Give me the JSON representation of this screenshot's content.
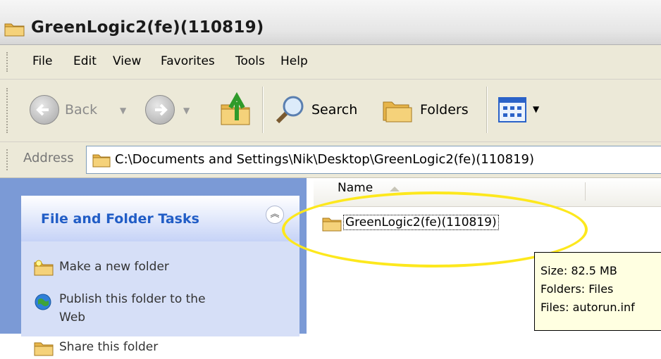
{
  "window": {
    "title": "GreenLogic2(fe)(110819)"
  },
  "menu": [
    {
      "label": "File"
    },
    {
      "label": "Edit"
    },
    {
      "label": "View"
    },
    {
      "label": "Favorites"
    },
    {
      "label": "Tools"
    },
    {
      "label": "Help"
    }
  ],
  "toolbar": {
    "back_label": "Back",
    "search_label": "Search",
    "folders_label": "Folders"
  },
  "address": {
    "label": "Address",
    "path": "C:\\Documents and Settings\\Nik\\Desktop\\GreenLogic2(fe)(110819)"
  },
  "tasks": {
    "title": "File and Folder Tasks",
    "items": [
      {
        "label": "Make a new folder"
      },
      {
        "label": "Publish this folder to the"
      },
      {
        "label": "Web"
      },
      {
        "label": "Share this folder"
      }
    ]
  },
  "list": {
    "column_name": "Name",
    "item": "GreenLogic2(fe)(110819)"
  },
  "tooltip": {
    "size": "Size: 82.5 MB",
    "folders": "Folders: Files",
    "files": "Files: autorun.inf"
  },
  "colors": {
    "highlight": "#fde81d",
    "task_title": "#215dc6",
    "task_bg": "#d6dff7",
    "sidebar_bg": "#7b9ad6",
    "tooltip_bg": "#ffffe1"
  }
}
